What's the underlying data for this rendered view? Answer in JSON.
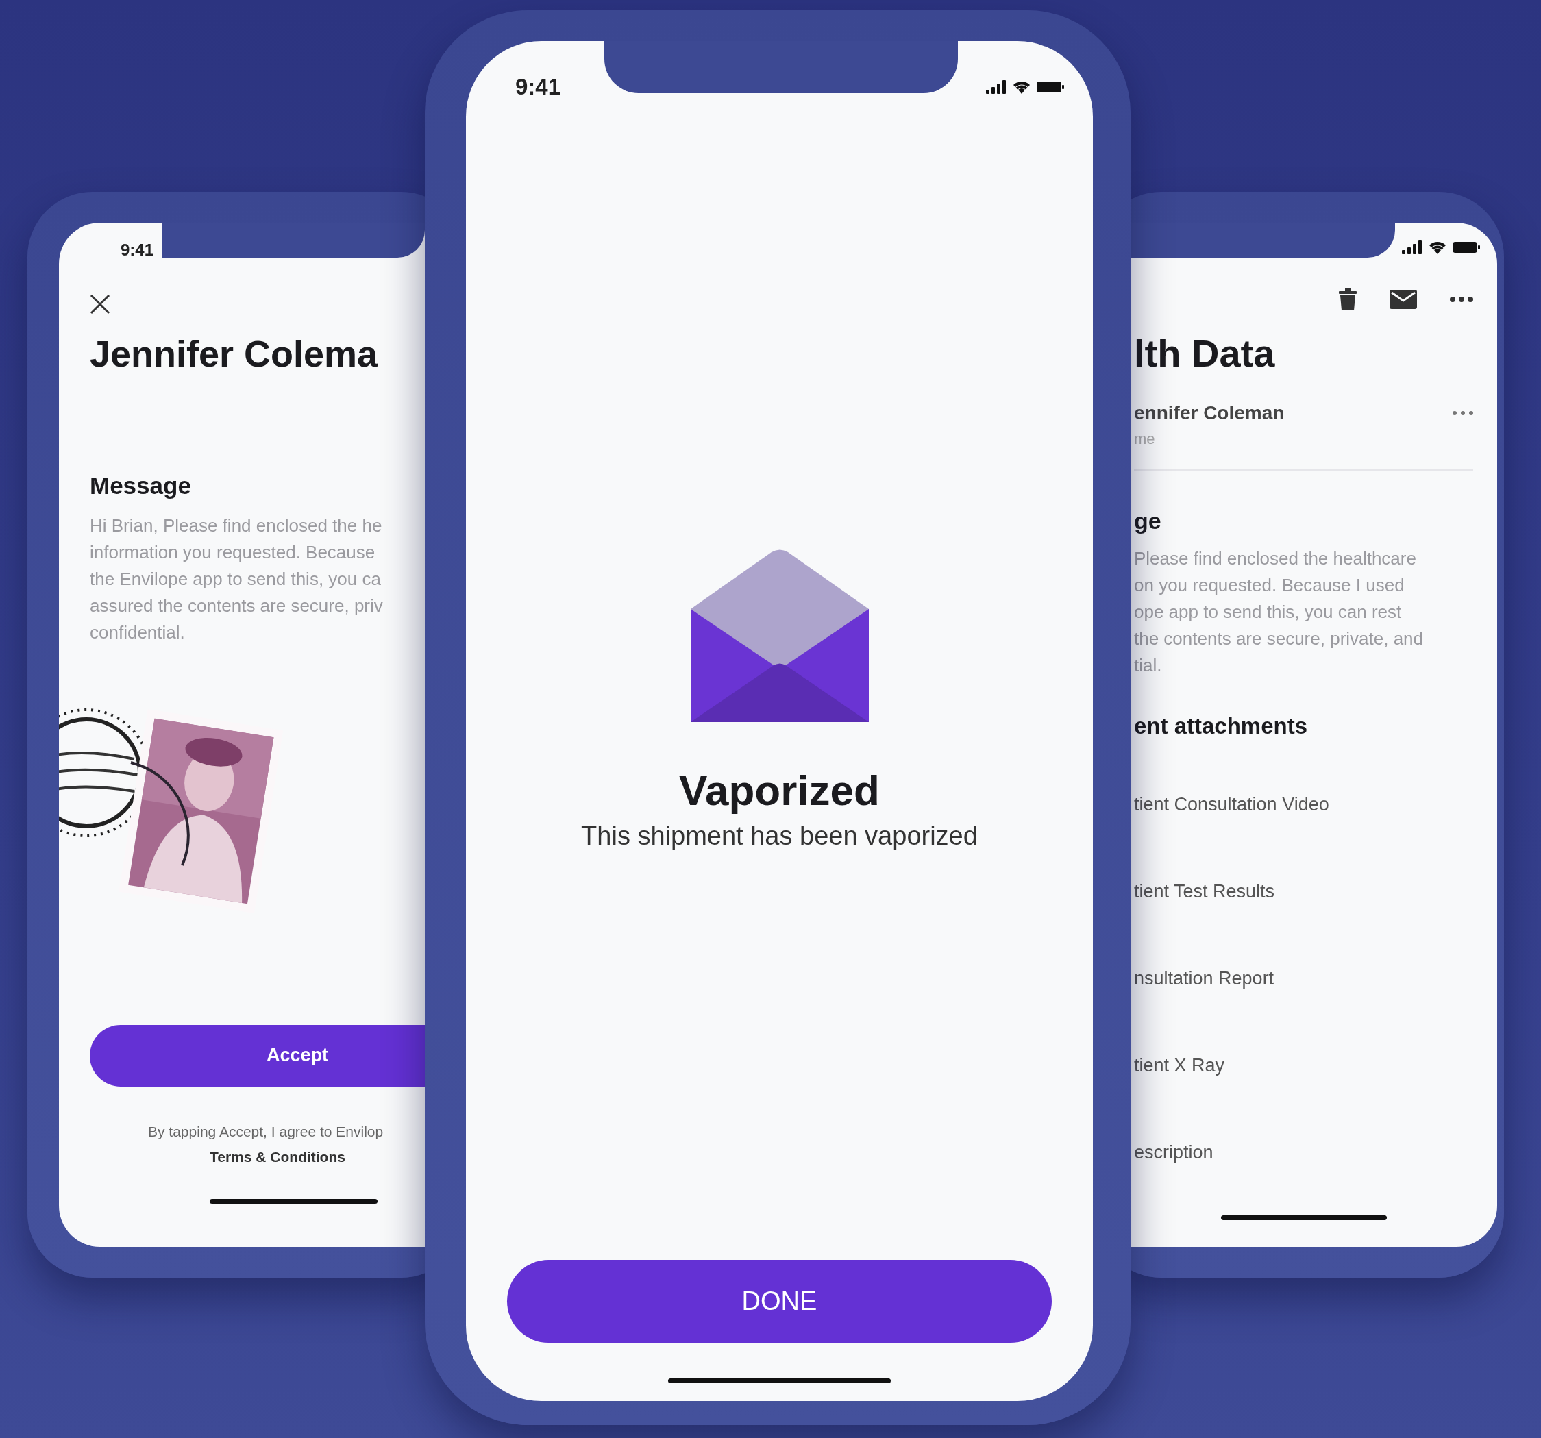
{
  "left_phone": {
    "status_time": "9:41",
    "title": "Jennifer Colema",
    "section_label": "Message",
    "message_lines": [
      "Hi Brian, Please find enclosed the he",
      "information you requested. Because",
      "the Envilope app to send this, you ca",
      "assured the contents are secure, priv",
      "confidential."
    ],
    "accept_button": "Accept",
    "terms_text": "By tapping Accept, I agree to Envilop",
    "terms_link": "Terms & Conditions"
  },
  "center_phone": {
    "status_time": "9:41",
    "title": "Vaporized",
    "subtitle": "This shipment has been vaporized",
    "done_button": "DONE"
  },
  "right_phone": {
    "title": "lth Data",
    "sender": "ennifer Coleman",
    "recipient": "me",
    "section_label": "ge",
    "message_lines": [
      "Please find enclosed the healthcare",
      "on you requested. Because I used",
      "ope app to send this, you can rest",
      "the contents are secure, private, and",
      "tial."
    ],
    "attachments_label": "ent attachments",
    "attachments": [
      "tient Consultation Video",
      "tient Test Results",
      "nsultation Report",
      "tient X Ray",
      "escription"
    ]
  }
}
